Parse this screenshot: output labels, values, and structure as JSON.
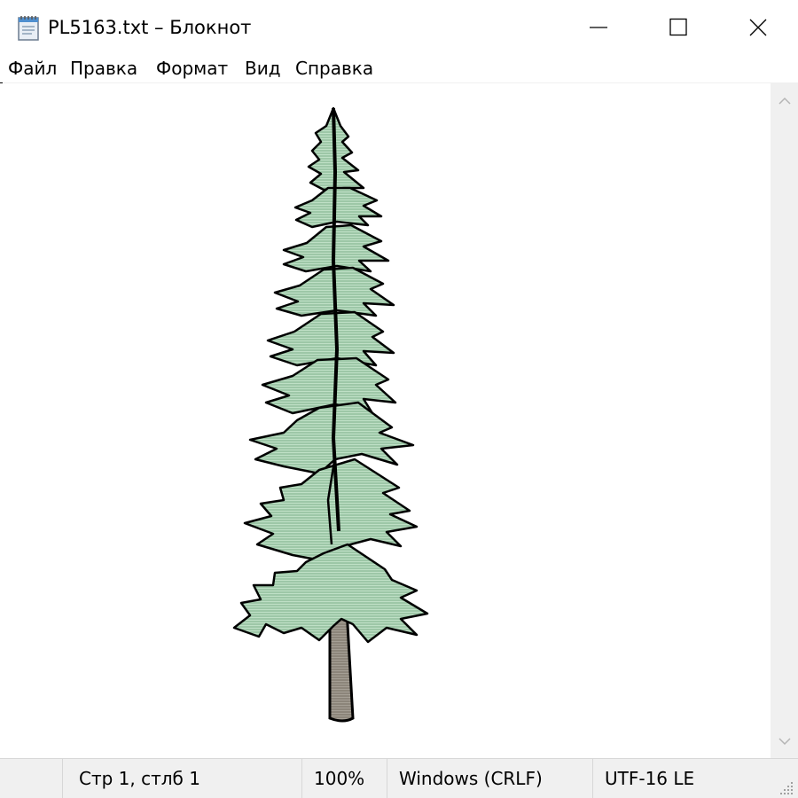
{
  "window": {
    "title": "PL5163.txt – Блокнот",
    "app_icon": "notepad-icon",
    "controls": [
      "minimize-icon",
      "maximize-icon",
      "close-icon"
    ]
  },
  "menu": {
    "items": [
      {
        "label": "Файл"
      },
      {
        "label": "Правка"
      },
      {
        "label": "Формат"
      },
      {
        "label": "Вид"
      },
      {
        "label": "Справка"
      }
    ]
  },
  "editor": {
    "content_image": "conifer-tree-ascii-art",
    "colors": {
      "foliage": "#9dc7a7",
      "trunk": "#8c857a",
      "outline": "#000000"
    }
  },
  "status": {
    "position": "Стр 1, стлб 1",
    "zoom": "100%",
    "line_endings": "Windows (CRLF)",
    "encoding": "UTF-16 LE"
  }
}
